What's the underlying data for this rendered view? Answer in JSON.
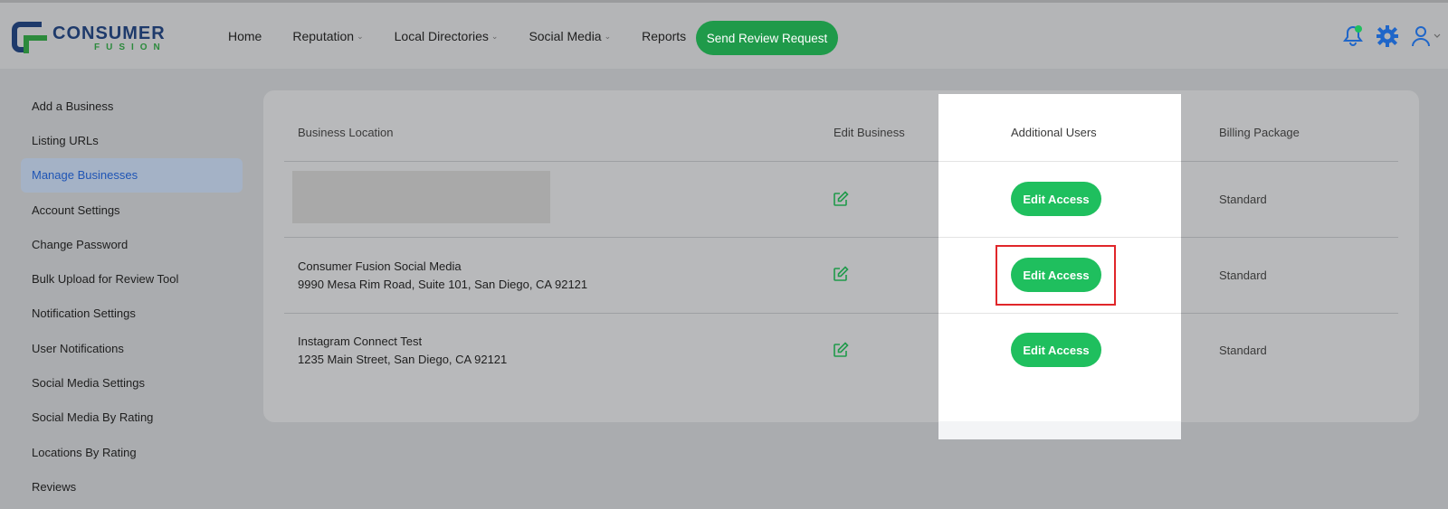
{
  "brand": {
    "name": "CONSUMER",
    "sub": "FUSION"
  },
  "nav": {
    "items": [
      {
        "label": "Home",
        "dropdown": false
      },
      {
        "label": "Reputation",
        "dropdown": true
      },
      {
        "label": "Local Directories",
        "dropdown": true
      },
      {
        "label": "Social Media",
        "dropdown": true
      },
      {
        "label": "Reports",
        "dropdown": false
      }
    ],
    "cta_label": "Send Review Request",
    "icons": [
      "bell-icon",
      "gear-icon",
      "user-icon"
    ]
  },
  "sidebar": {
    "items": [
      {
        "label": "Add a Business"
      },
      {
        "label": "Listing URLs"
      },
      {
        "label": "Manage Businesses",
        "active": true
      },
      {
        "label": "Account Settings"
      },
      {
        "label": "Change Password"
      },
      {
        "label": "Bulk Upload for Review Tool"
      },
      {
        "label": "Notification Settings"
      },
      {
        "label": "User Notifications"
      },
      {
        "label": "Social Media Settings"
      },
      {
        "label": "Social Media By Rating"
      },
      {
        "label": "Locations By Rating"
      },
      {
        "label": "Reviews"
      }
    ]
  },
  "table": {
    "headers": {
      "location": "Business Location",
      "edit": "Edit Business",
      "users": "Additional Users",
      "billing": "Billing Package"
    },
    "rows": [
      {
        "name": "",
        "address": "",
        "action": "Edit Access",
        "package": "Standard"
      },
      {
        "name": "Consumer Fusion Social Media",
        "address": "9990 Mesa Rim Road, Suite 101, San Diego, CA 92121",
        "action": "Edit Access",
        "package": "Standard"
      },
      {
        "name": "Instagram Connect Test",
        "address": "1235 Main Street, San Diego, CA 92121",
        "action": "Edit Access",
        "package": "Standard"
      }
    ]
  },
  "colors": {
    "primary_green": "#1fbf5e",
    "nav_green": "#1f9a4a",
    "active_blue": "#1f55b5",
    "highlight_red": "#e0262a"
  }
}
